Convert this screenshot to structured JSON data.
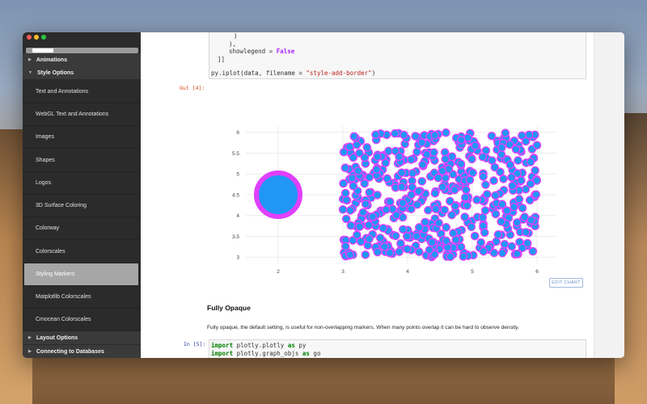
{
  "sidebar": {
    "sections": [
      {
        "label": "Animations",
        "expanded": false
      },
      {
        "label": "Style Options",
        "expanded": true
      },
      {
        "label": "Layout Options",
        "expanded": false
      },
      {
        "label": "Connecting to Databases",
        "expanded": false
      }
    ],
    "items": [
      {
        "label": "Text and Annotations"
      },
      {
        "label": "WebGL Text and Annotations"
      },
      {
        "label": "Images"
      },
      {
        "label": "Shapes"
      },
      {
        "label": "Logos"
      },
      {
        "label": "3D Surface Coloring"
      },
      {
        "label": "Colorway"
      },
      {
        "label": "Colorscales"
      },
      {
        "label": "Styling Markers",
        "active": true
      },
      {
        "label": "Matplotlib Colorscales"
      },
      {
        "label": "Cmocean Colorscales"
      }
    ]
  },
  "code_top": {
    "line1": ")",
    "line2": "),",
    "line3_key": "showlegend = ",
    "line3_val": "False",
    "line4": "]]",
    "line5_pre": "py.iplot(data, filename = ",
    "line5_str": "\"style-add-border\"",
    "line5_post": ")"
  },
  "out_label": "Out [4]:",
  "edit_chart_label": "EDIT CHART",
  "section_heading": "Fully Opaque",
  "section_text": "Fully opaque, the default setting, is useful for non-overlapping markers. When many points overlap it can be hard to observe density.",
  "in_label": "In [5]:",
  "code_bottom": {
    "line1_kw": "import",
    "line1_mod": " plotly.plotly ",
    "line1_as": "as",
    "line1_alias": " py",
    "line2_kw": "import",
    "line2_mod": " plotly.graph_objs ",
    "line2_as": "as",
    "line2_alias": " go"
  },
  "colors": {
    "marker_fill": "#2196f3",
    "marker_border": "#e040fb",
    "sidebar_bg": "#2b2b2b",
    "active_item": "#a6a6a6"
  },
  "chart_data": {
    "type": "scatter",
    "title": "",
    "xlabel": "",
    "ylabel": "",
    "xlim": [
      1.5,
      6.3
    ],
    "ylim": [
      2.85,
      6.15
    ],
    "x_ticks": [
      "2",
      "3",
      "4",
      "5",
      "6"
    ],
    "y_ticks": [
      "3",
      "3.5",
      "4",
      "4.5",
      "5",
      "5.5",
      "6"
    ],
    "grid": true,
    "series": [
      {
        "points": [
          [
            2.0,
            4.5
          ]
        ],
        "marker": "large",
        "fill": "#2196f3",
        "border": "#e040fb"
      },
      {
        "region": {
          "x": [
            3.0,
            6.0
          ],
          "y": [
            3.0,
            6.0
          ]
        },
        "count": 500,
        "marker": "small",
        "fill": "#2196f3",
        "border": "#e040fb"
      }
    ]
  }
}
